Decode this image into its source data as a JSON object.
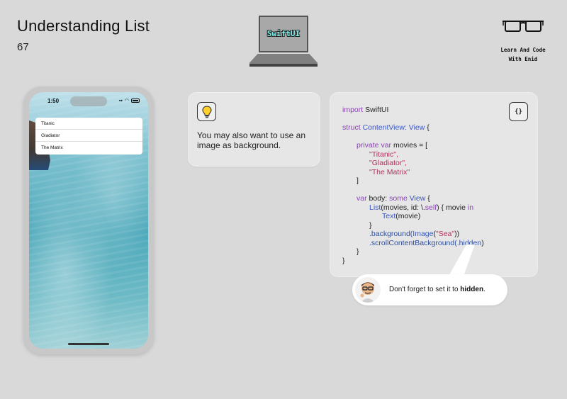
{
  "header": {
    "title": "Understanding List",
    "page_number": "67"
  },
  "logo": {
    "laptop_text": "SwiftUI",
    "brand_line1": "Learn And Code",
    "brand_line2": "With Enid"
  },
  "phone": {
    "time": "1:50",
    "movies": [
      "Titanic",
      "Gladiator",
      "The Matrix"
    ]
  },
  "tip": {
    "icon": "lightbulb-icon",
    "text": "You may also want to use an image as background."
  },
  "code": {
    "icon": "curly-braces-icon",
    "lines": {
      "l1": [
        "import",
        " SwiftUI"
      ],
      "l2": [
        "struct",
        " ContentView: ",
        "View",
        " {"
      ],
      "l3": [
        "private",
        " ",
        "var",
        " movies = ["
      ],
      "l4": "\"Titanic\",",
      "l5": "\"Gladiator\",",
      "l6": "\"The Matrix\"",
      "l7": "]",
      "l8": [
        "var",
        " body: ",
        "some",
        " ",
        "View",
        " {"
      ],
      "l9": [
        "List",
        "(movies, id: \\.",
        "self",
        ") { movie ",
        "in"
      ],
      "l10": [
        "Text",
        "(movie)"
      ],
      "l11": "}",
      "l12": [
        ".background(",
        "Image",
        "(",
        "\"Sea\"",
        "))"
      ],
      "l13": [
        ".scrollContentBackground(",
        ".hidden",
        ")"
      ],
      "l14": "}",
      "l15": "}"
    }
  },
  "bubble": {
    "text": "Don't forget to set it to ",
    "emphasis": "hidden",
    "end": "."
  }
}
